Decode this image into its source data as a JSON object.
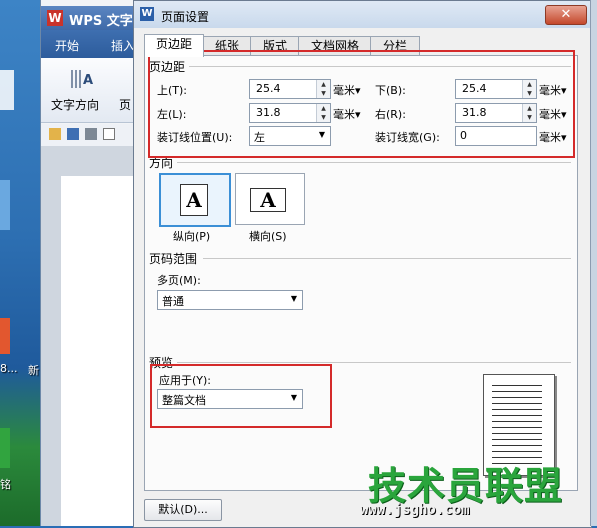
{
  "background_app": {
    "title": "WPS 文字",
    "tabs": [
      "开始",
      "插入"
    ],
    "ribbon": {
      "text_direction": "文字方向",
      "page_next": "页"
    },
    "desktop_labels": [
      "8...",
      "新",
      "铭"
    ]
  },
  "dialog": {
    "title": "页面设置",
    "close_glyph": "✕",
    "tabs": [
      "页边距",
      "纸张",
      "版式",
      "文档网格",
      "分栏"
    ],
    "active_tab": "页边距",
    "margins": {
      "group_title": "页边距",
      "top": {
        "label": "上(T):",
        "value": "25.4",
        "unit": "毫米▾"
      },
      "bottom": {
        "label": "下(B):",
        "value": "25.4",
        "unit": "毫米▾"
      },
      "left": {
        "label": "左(L):",
        "value": "31.8",
        "unit": "毫米▾"
      },
      "right": {
        "label": "右(R):",
        "value": "31.8",
        "unit": "毫米▾"
      },
      "gutter_position": {
        "label": "装订线位置(U):",
        "value": "左"
      },
      "gutter": {
        "label": "装订线宽(G):",
        "value": "0",
        "unit": "毫米▾"
      }
    },
    "orientation": {
      "group_title": "方向",
      "portrait": {
        "glyph": "A",
        "label": "纵向(P)"
      },
      "landscape": {
        "glyph": "A",
        "label": "横向(S)"
      },
      "selected": "portrait"
    },
    "page_range": {
      "group_title": "页码范围",
      "multiple_pages_label": "多页(M):",
      "multiple_pages_value": "普通"
    },
    "preview": {
      "group_title": "预览",
      "apply_to_label": "应用于(Y):",
      "apply_to_value": "整篇文档"
    },
    "default_button": "默认(D)..."
  },
  "watermark": {
    "text": "技术员联盟",
    "url": "www.jsgho.com"
  },
  "colors": {
    "highlight_box": "#d42a2a",
    "selected_border": "#3b8fd6",
    "watermark": "#2aa53c"
  }
}
